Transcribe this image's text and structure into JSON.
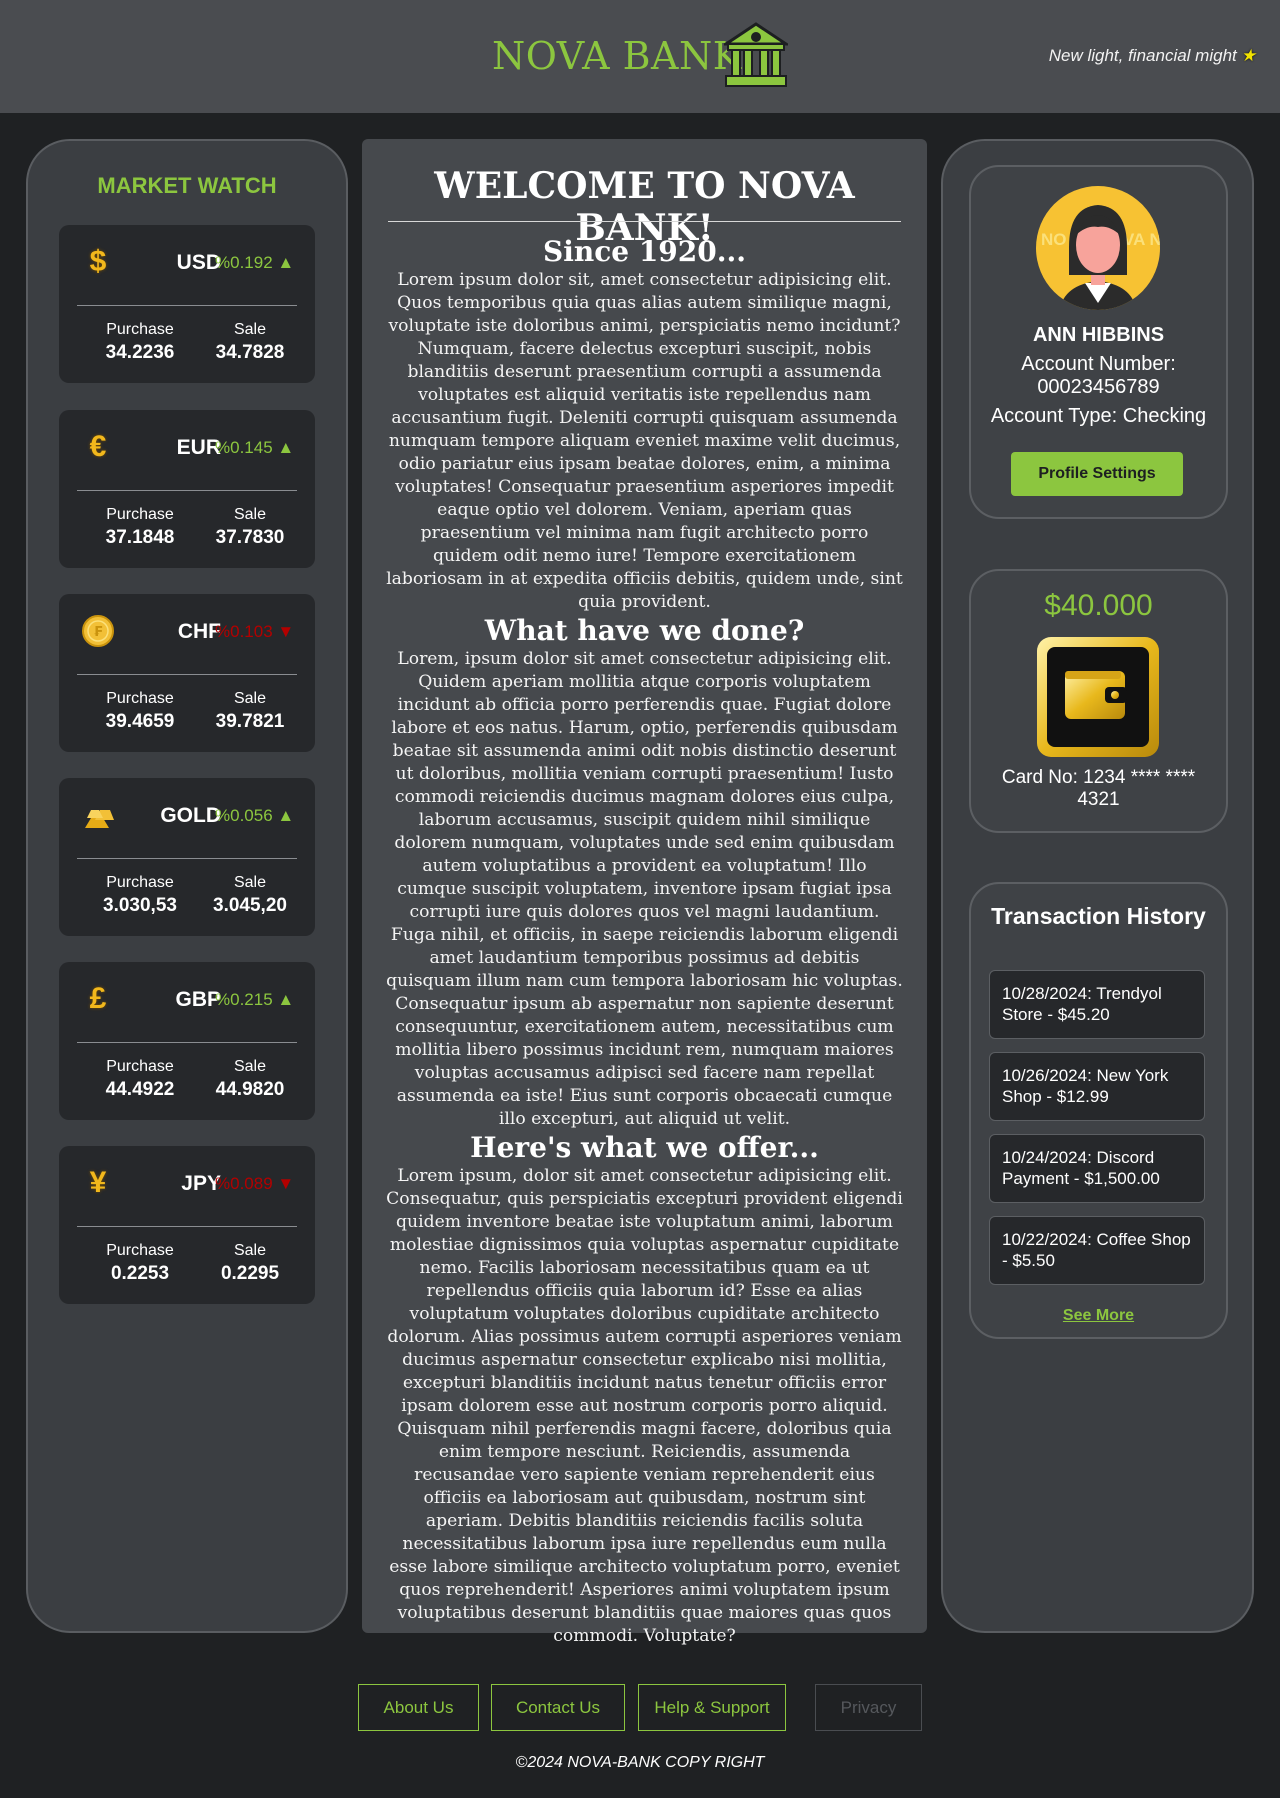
{
  "header": {
    "brand": "NOVA BANK",
    "tagline": "New light, financial might",
    "star": "★"
  },
  "market": {
    "title": "MARKET WATCH",
    "purchase_label": "Purchase",
    "sale_label": "Sale",
    "items": [
      {
        "code": "USD",
        "icon": "dollar-icon",
        "glyph": "$",
        "change": "%0.192 ▲",
        "trend": "up",
        "purchase": "34.2236",
        "sale": "34.7828"
      },
      {
        "code": "EUR",
        "icon": "euro-icon",
        "glyph": "€",
        "change": "%0.145 ▲",
        "trend": "up",
        "purchase": "37.1848",
        "sale": "37.7830"
      },
      {
        "code": "CHF",
        "icon": "franc-coin-icon",
        "glyph": "₣",
        "change": "%0.103 ▼",
        "trend": "down",
        "purchase": "39.4659",
        "sale": "39.7821"
      },
      {
        "code": "GOLD",
        "icon": "gold-bars-icon",
        "glyph": "",
        "change": "%0.056 ▲",
        "trend": "up",
        "purchase": "3.030,53",
        "sale": "3.045,20"
      },
      {
        "code": "GBP",
        "icon": "pound-icon",
        "glyph": "£",
        "change": "%0.215 ▲",
        "trend": "up",
        "purchase": "44.4922",
        "sale": "44.9820"
      },
      {
        "code": "JPY",
        "icon": "yen-icon",
        "glyph": "¥",
        "change": "%0.089 ▼",
        "trend": "down",
        "purchase": "0.2253",
        "sale": "0.2295"
      }
    ]
  },
  "article": {
    "title": "WELCOME TO NOVA BANK!",
    "sections": [
      {
        "heading": "Since 1920...",
        "text": "Lorem ipsum dolor sit, amet consectetur adipisicing elit. Quos temporibus quia quas alias autem similique magni, voluptate iste doloribus animi, perspiciatis nemo incidunt? Numquam, facere delectus excepturi suscipit, nobis blanditiis deserunt praesentium corrupti a assumenda voluptates est aliquid veritatis iste repellendus nam accusantium fugit. Deleniti corrupti quisquam assumenda numquam tempore aliquam eveniet maxime velit ducimus, odio pariatur eius ipsam beatae dolores, enim, a minima voluptates! Consequatur praesentium asperiores impedit eaque optio vel dolorem. Veniam, aperiam quas praesentium vel minima nam fugit architecto porro quidem odit nemo iure! Tempore exercitationem laboriosam in at expedita officiis debitis, quidem unde, sint quia provident."
      },
      {
        "heading": "What have we done?",
        "text": "Lorem, ipsum dolor sit amet consectetur adipisicing elit. Quidem aperiam mollitia atque corporis voluptatem incidunt ab officia porro perferendis quae. Fugiat dolore labore et eos natus. Harum, optio, perferendis quibusdam beatae sit assumenda animi odit nobis distinctio deserunt ut doloribus, mollitia veniam corrupti praesentium! Iusto commodi reiciendis ducimus magnam dolores eius culpa, laborum accusamus, suscipit quidem nihil similique dolorem numquam, voluptates unde sed enim quibusdam autem voluptatibus a provident ea voluptatum! Illo cumque suscipit voluptatem, inventore ipsam fugiat ipsa corrupti iure quis dolores quos vel magni laudantium. Fuga nihil, et officiis, in saepe reiciendis laborum eligendi amet laudantium temporibus possimus ad debitis quisquam illum nam cum tempora laboriosam hic voluptas. Consequatur ipsum ab aspernatur non sapiente deserunt consequuntur, exercitationem autem, necessitatibus cum mollitia libero possimus incidunt rem, numquam maiores voluptas accusamus adipisci sed facere nam repellat assumenda ea iste! Eius sunt corporis obcaecati cumque illo excepturi, aut aliquid ut velit."
      },
      {
        "heading": "Here's what we offer...",
        "text": "Lorem ipsum, dolor sit amet consectetur adipisicing elit. Consequatur, quis perspiciatis excepturi provident eligendi quidem inventore beatae iste voluptatum animi, laborum molestiae dignissimos quia voluptas aspernatur cupiditate nemo. Facilis laboriosam necessitatibus quam ea ut repellendus officiis quia laborum id? Esse ea alias voluptatum voluptates doloribus cupiditate architecto dolorum. Alias possimus autem corrupti asperiores veniam ducimus aspernatur consectetur explicabo nisi mollitia, excepturi blanditiis incidunt natus tenetur officiis error ipsam dolorem esse aut nostrum corporis porro aliquid. Quisquam nihil perferendis magni facere, doloribus quia enim tempore nesciunt. Reiciendis, assumenda recusandae vero sapiente veniam reprehenderit eius officiis ea laboriosam aut quibusdam, nostrum sint aperiam. Debitis blanditiis reiciendis facilis soluta necessitatibus laborum ipsa iure repellendus eum nulla esse labore similique architecto voluptatum porro, eveniet quos reprehenderit! Asperiores animi voluptatem ipsum voluptatibus deserunt blanditiis quae maiores quas quos commodi. Voluptate?"
      }
    ]
  },
  "profile": {
    "name": "ANN HIBBINS",
    "account_number_label": "Account Number:",
    "account_number": "00023456789",
    "account_type": "Account Type: Checking",
    "settings_button": "Profile Settings",
    "avatar_watermark_left": "NO BA",
    "avatar_watermark_right": "VA NK"
  },
  "wallet": {
    "balance": "$40.000",
    "card_no": "Card No: 1234 **** **** 4321"
  },
  "transactions": {
    "title": "Transaction History",
    "items": [
      "10/28/2024: Trendyol Store - $45.20",
      "10/26/2024: New York Shop - $12.99",
      "10/24/2024: Discord Payment - $1,500.00",
      "10/22/2024: Coffee Shop - $5.50"
    ],
    "see_more": "See More"
  },
  "footer": {
    "links": [
      "About Us",
      "Contact Us",
      "Help & Support",
      "Privacy"
    ],
    "copyright": "©2024 NOVA-BANK COPY RIGHT"
  },
  "colors": {
    "accent": "#8cc63f",
    "down": "#b30000",
    "page_bg": "#1f2123",
    "header_bg": "#4a4c50"
  }
}
